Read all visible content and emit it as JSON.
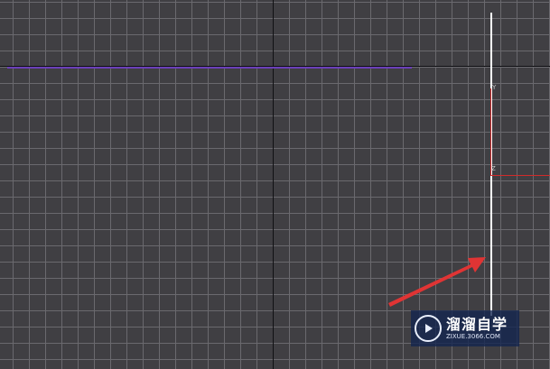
{
  "viewport": {
    "gizmo": {
      "y_label": "Y",
      "z_label": "Z"
    }
  },
  "colors": {
    "background": "#403f43",
    "grid": "#6a696e",
    "axis": "#101013",
    "gizmo": "#d12b2b",
    "annotation_arrow": "#e03434"
  },
  "watermark": {
    "title": "溜溜自学",
    "url": "ZIXUE.3066.COM"
  }
}
